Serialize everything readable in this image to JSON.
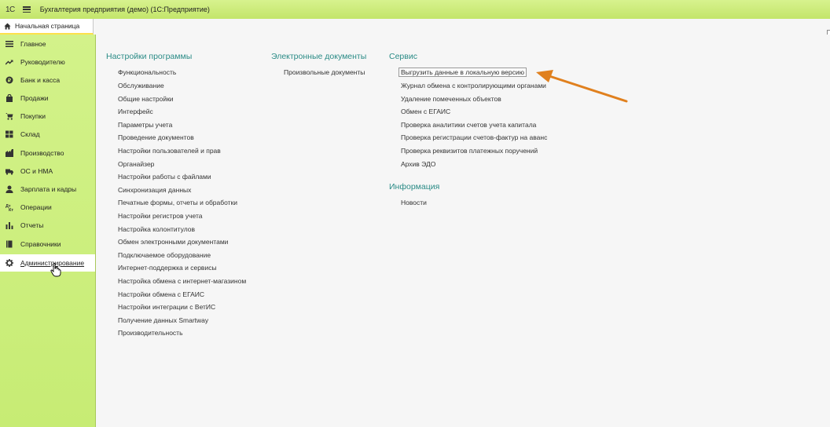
{
  "app": {
    "logo": "1С",
    "title": "Бухгалтерия предприятия (демо)  (1С:Предприятие)"
  },
  "tabs": {
    "home": "Начальная страница"
  },
  "sidebar": {
    "items": [
      {
        "label": "Главное",
        "icon": "menu-icon"
      },
      {
        "label": "Руководителю",
        "icon": "trend-icon"
      },
      {
        "label": "Банк и касса",
        "icon": "coin-icon"
      },
      {
        "label": "Продажи",
        "icon": "bag-icon"
      },
      {
        "label": "Покупки",
        "icon": "cart-icon"
      },
      {
        "label": "Склад",
        "icon": "warehouse-icon"
      },
      {
        "label": "Производство",
        "icon": "factory-icon"
      },
      {
        "label": "ОС и НМА",
        "icon": "truck-icon"
      },
      {
        "label": "Зарплата и кадры",
        "icon": "person-icon"
      },
      {
        "label": "Операции",
        "icon": "operations-icon"
      },
      {
        "label": "Отчеты",
        "icon": "bar-chart-icon"
      },
      {
        "label": "Справочники",
        "icon": "book-icon"
      },
      {
        "label": "Администрирование",
        "icon": "gear-icon"
      }
    ]
  },
  "sections": {
    "settings": {
      "title": "Настройки программы",
      "items": [
        "Функциональность",
        "Обслуживание",
        "Общие настройки",
        "Интерфейс",
        "Параметры учета",
        "Проведение документов",
        "Настройки пользователей и прав",
        "Органайзер",
        "Настройки работы с файлами",
        "Синхронизация данных",
        "Печатные формы, отчеты и обработки",
        "Настройки регистров учета",
        "Настройка колонтитулов",
        "Обмен электронными документами",
        "Подключаемое оборудование",
        "Интернет-поддержка и сервисы",
        "Настройка обмена с интернет-магазином",
        "Настройки обмена с ЕГАИС",
        "Настройки интеграции с ВетИС",
        "Получение данных Smartway",
        "Производительность"
      ]
    },
    "edocs": {
      "title": "Электронные документы",
      "items": [
        "Произвольные документы"
      ]
    },
    "service": {
      "title": "Сервис",
      "items": [
        "Выгрузить данные в локальную версию",
        "Журнал обмена с контролирующими органами",
        "Удаление помеченных объектов",
        "Обмен с ЕГАИС",
        "Проверка аналитики счетов учета капитала",
        "Проверка регистрации счетов-фактур на аванс",
        "Проверка реквизитов платежных поручений",
        "Архив ЭДО"
      ]
    },
    "info": {
      "title": "Информация",
      "items": [
        "Новости"
      ]
    }
  },
  "colors": {
    "sidebar": "#c9ee78",
    "section_title": "#2a8b86",
    "annotation_arrow": "#e0801e"
  }
}
